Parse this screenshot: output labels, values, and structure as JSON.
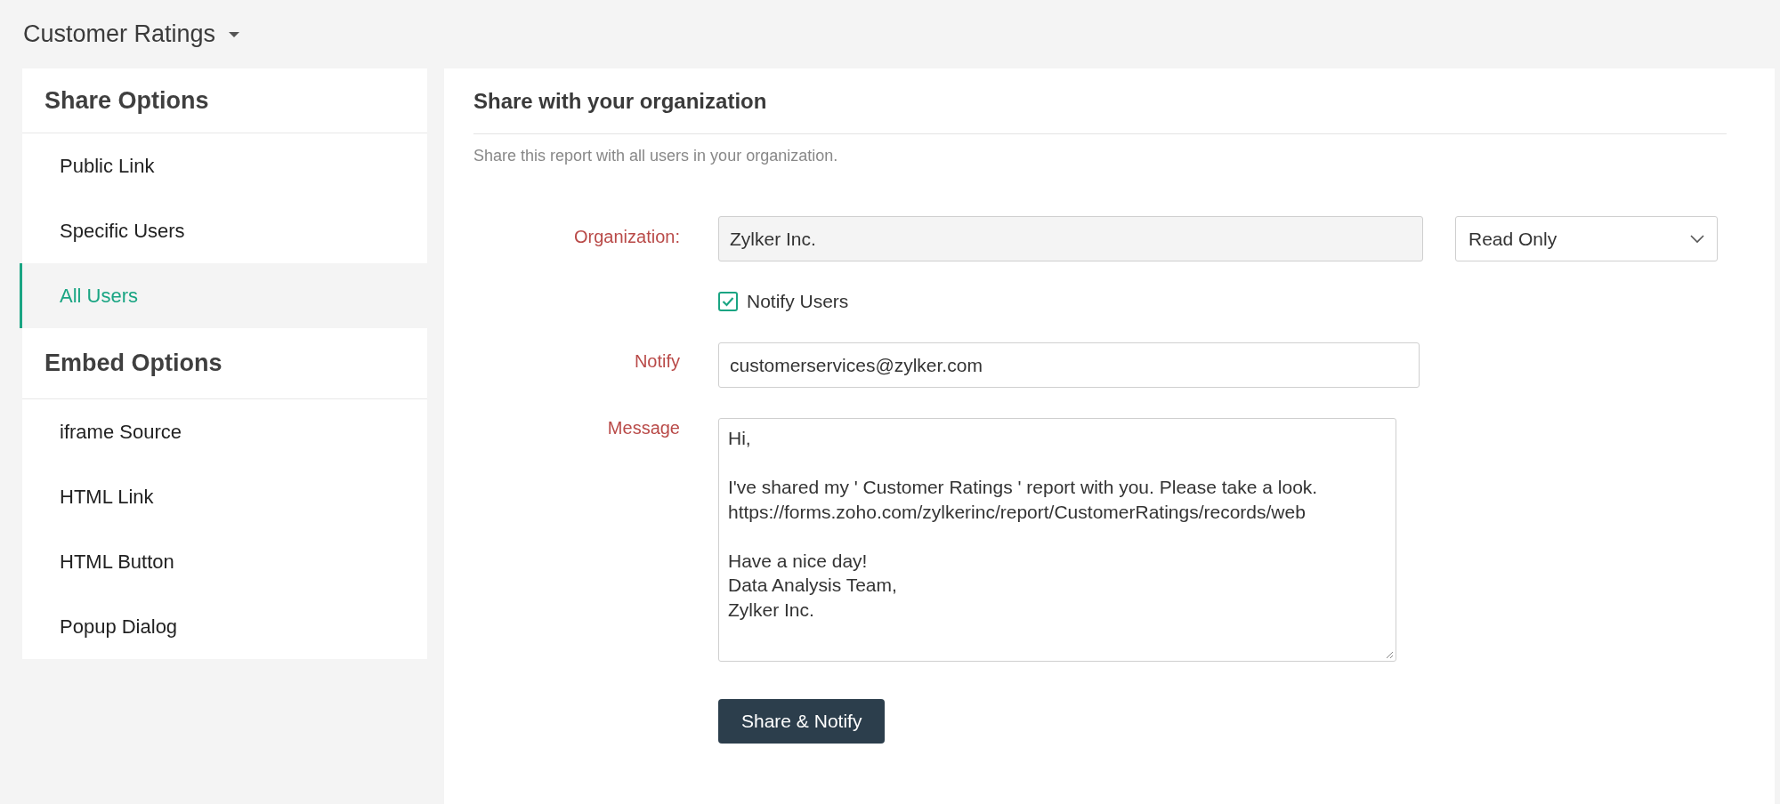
{
  "header": {
    "title": "Customer Ratings"
  },
  "sidebar": {
    "sections": [
      {
        "title": "Share Options",
        "items": [
          {
            "label": "Public Link",
            "selected": false
          },
          {
            "label": "Specific Users",
            "selected": false
          },
          {
            "label": "All Users",
            "selected": true
          }
        ]
      },
      {
        "title": "Embed Options",
        "items": [
          {
            "label": "iframe Source",
            "selected": false
          },
          {
            "label": "HTML Link",
            "selected": false
          },
          {
            "label": "HTML Button",
            "selected": false
          },
          {
            "label": "Popup Dialog",
            "selected": false
          }
        ]
      }
    ]
  },
  "panel": {
    "title": "Share with your organization",
    "description": "Share this report with all users in your organization.",
    "organization": {
      "label": "Organization:",
      "value": "Zylker Inc.",
      "permission": "Read Only"
    },
    "notify_users": {
      "label": "Notify Users",
      "checked": true
    },
    "notify": {
      "label": "Notify",
      "value": "customerservices@zylker.com"
    },
    "message": {
      "label": "Message",
      "value": "Hi,\n\nI've shared my ' Customer Ratings ' report with you. Please take a look.\nhttps://forms.zoho.com/zylkerinc/report/CustomerRatings/records/web\n\nHave a nice day!\nData Analysis Team,\nZylker Inc."
    },
    "button": "Share & Notify"
  }
}
